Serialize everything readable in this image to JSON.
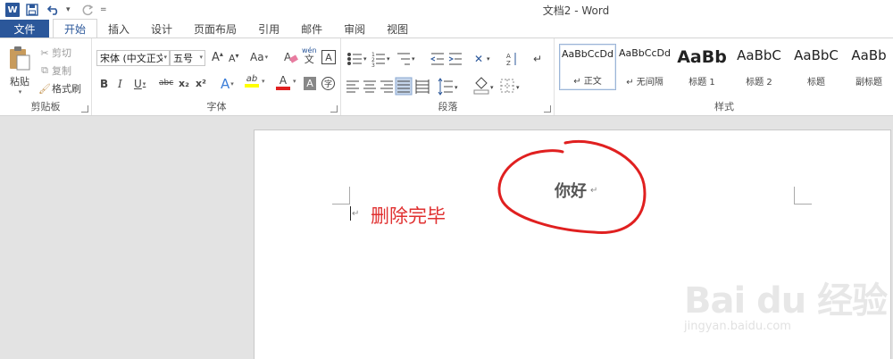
{
  "app": {
    "title": "文档2 - Word",
    "icons": {
      "app": "word-logo-icon",
      "save": "save-icon",
      "undo": "undo-icon",
      "redo": "redo-icon",
      "customize": "customize-qat-icon"
    }
  },
  "tabs": {
    "file": "文件",
    "items": [
      "开始",
      "插入",
      "设计",
      "页面布局",
      "引用",
      "邮件",
      "审阅",
      "视图"
    ],
    "active": "开始"
  },
  "clipboard": {
    "label": "剪贴板",
    "paste": "粘贴",
    "cut": "剪切",
    "copy": "复制",
    "format_painter": "格式刷"
  },
  "font": {
    "label": "字体",
    "font_name": "宋体 (中文正文)",
    "font_size": "五号",
    "grow": "A",
    "shrink": "A",
    "change_case": "Aa",
    "phonetic_top": "wén",
    "phonetic_bottom": "文",
    "bold": "B",
    "italic": "I",
    "underline": "U",
    "strike": "abc",
    "subscript": "x₂",
    "superscript": "x²",
    "text_effect": "A",
    "highlight": "ab",
    "font_color": "A",
    "char_shade": "A",
    "enclose": "字"
  },
  "paragraph": {
    "label": "段落"
  },
  "styles": {
    "label": "样式",
    "items": [
      {
        "preview": "AaBbCcDd",
        "name": "↵ 正文",
        "selected": true
      },
      {
        "preview": "AaBbCcDd",
        "name": "↵ 无间隔",
        "selected": false
      },
      {
        "preview": "AaBb",
        "name": "标题 1",
        "selected": false
      },
      {
        "preview": "AaBbC",
        "name": "标题 2",
        "selected": false
      },
      {
        "preview": "AaBbC",
        "name": "标题",
        "selected": false
      },
      {
        "preview": "AaBb",
        "name": "副标题",
        "selected": false
      }
    ]
  },
  "document": {
    "text": "你好",
    "paragraph_mark": "↵",
    "annotation": "删除完毕",
    "annotation_color": "#e03030",
    "circle_color": "#e02020"
  },
  "watermark": {
    "main": "Bai du 经验",
    "sub": "jingyan.baidu.com"
  },
  "colors": {
    "accent": "#2b579a",
    "font_color_bar": "#e02020",
    "highlight_bar": "#ffff00"
  }
}
